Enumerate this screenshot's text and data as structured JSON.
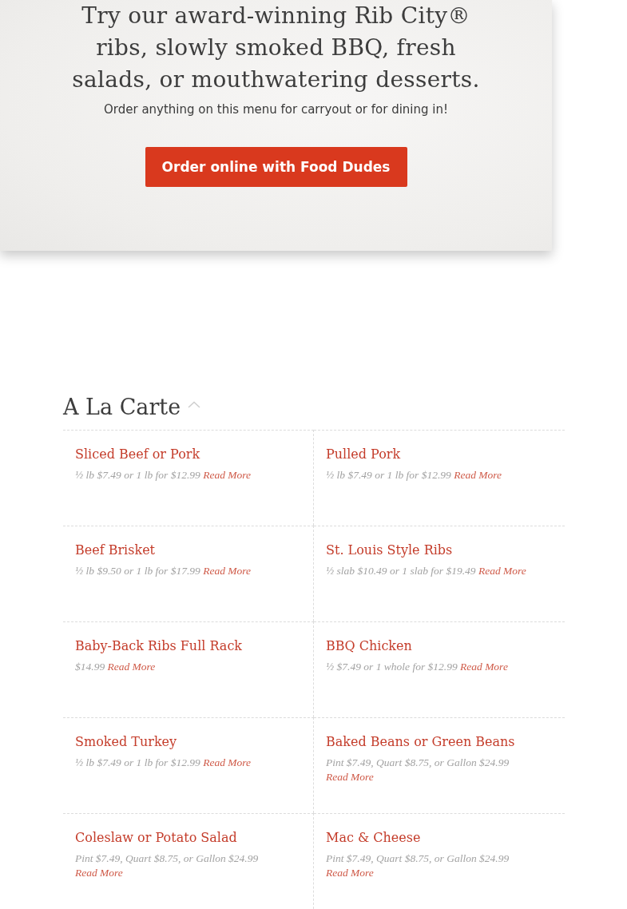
{
  "hero": {
    "heading": "Try our award-winning Rib City® ribs, slowly smoked BBQ, fresh salads, or mouthwatering desserts.",
    "subtext": "Order anything on this menu for carryout or for dining in!",
    "button": "Order online with Food Dudes"
  },
  "section": {
    "title": "A La Carte",
    "expanded": true,
    "items": [
      {
        "name": "Sliced Beef or Pork",
        "description": "½ lb $7.49 or 1 lb for $12.99",
        "link": "Read More"
      },
      {
        "name": "Pulled Pork",
        "description": "½ lb $7.49 or 1 lb for $12.99",
        "link": "Read More"
      },
      {
        "name": "Beef Brisket",
        "description": "½ lb $9.50 or 1 lb for $17.99",
        "link": "Read More"
      },
      {
        "name": "St. Louis Style Ribs",
        "description": "½ slab $10.49 or 1 slab for $19.49",
        "link": "Read More"
      },
      {
        "name": "Baby-Back Ribs Full Rack",
        "description": "$14.99",
        "link": "Read More"
      },
      {
        "name": "BBQ Chicken",
        "description": "½ $7.49 or 1 whole for $12.99",
        "link": "Read More"
      },
      {
        "name": "Smoked Turkey",
        "description": "½ lb $7.49 or 1 lb for $12.99",
        "link": "Read More"
      },
      {
        "name": "Baked Beans or Green Beans",
        "description": "Pint $7.49, Quart $8.75, or Gallon $24.99",
        "link": "Read More"
      },
      {
        "name": "Coleslaw or Potato Salad",
        "description": "Pint $7.49, Quart $8.75, or Gallon $24.99",
        "link": "Read More"
      },
      {
        "name": "Mac & Cheese",
        "description": "Pint $7.49, Quart $8.75, or Gallon $24.99",
        "link": "Read More"
      }
    ]
  }
}
